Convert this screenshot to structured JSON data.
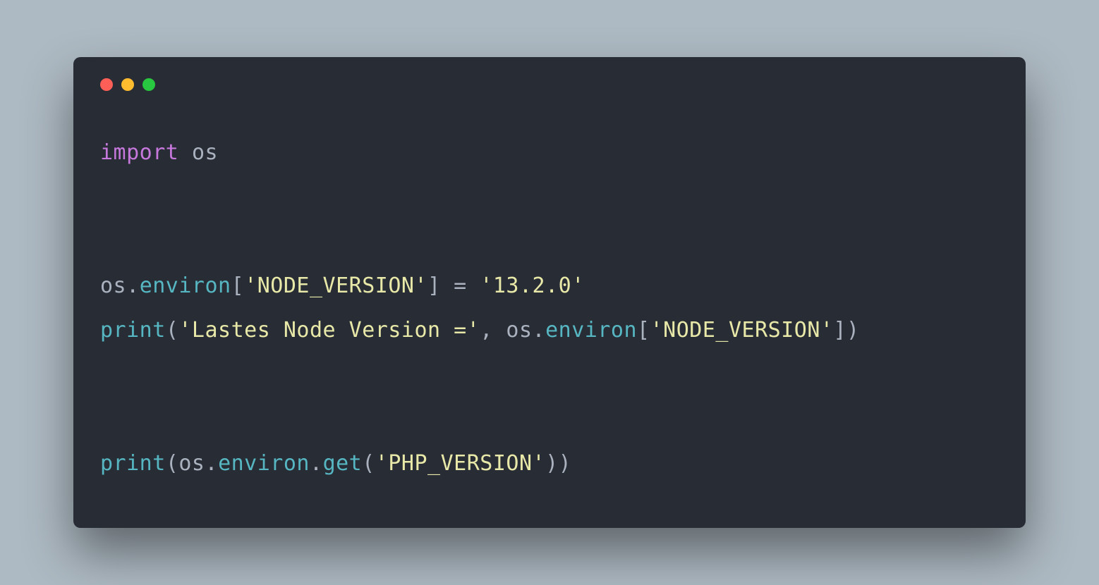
{
  "window": {
    "traffic_lights": [
      "red",
      "yellow",
      "green"
    ]
  },
  "code": {
    "line1": {
      "import": "import",
      "os": "os"
    },
    "line3": {
      "os_dot": "os.",
      "environ": "environ",
      "open": "[",
      "key": "'NODE_VERSION'",
      "close_assign": "] = ",
      "val": "'13.2.0'"
    },
    "line4": {
      "print": "print",
      "open": "(",
      "msg": "'Lastes Node Version ='",
      "comma": ", os.",
      "environ": "environ",
      "open2": "[",
      "key": "'NODE_VERSION'",
      "close": "])"
    },
    "line6": {
      "print": "print",
      "open": "(os.",
      "environ": "environ",
      "dot": ".",
      "get": "get",
      "open2": "(",
      "key": "'PHP_VERSION'",
      "close": "))"
    }
  }
}
